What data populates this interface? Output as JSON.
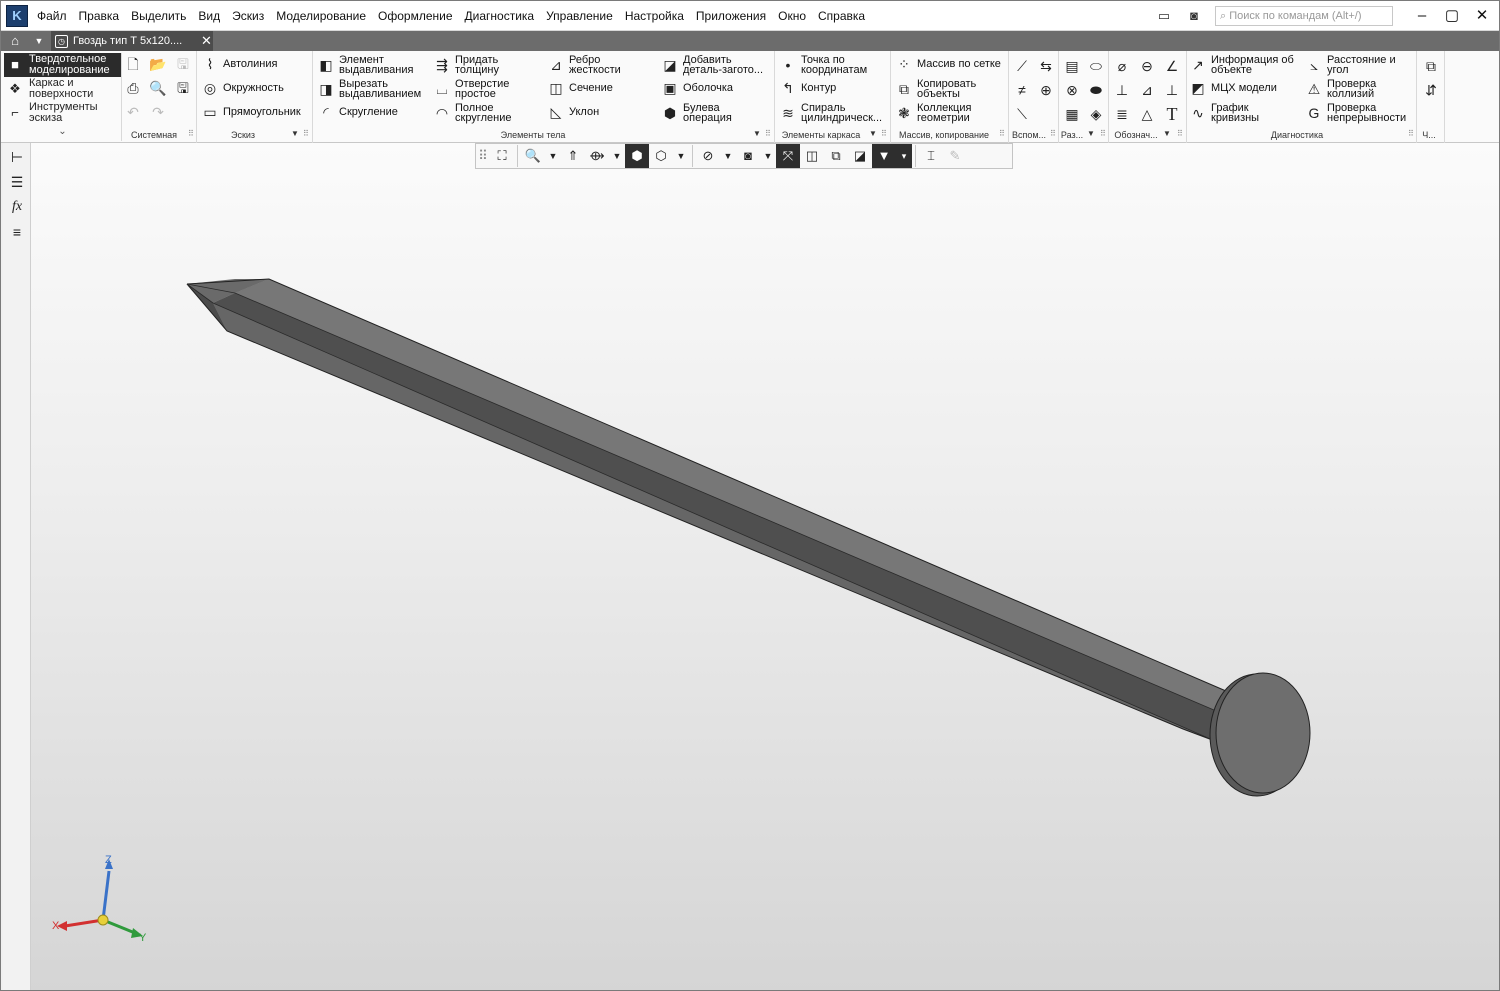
{
  "menu": [
    "Файл",
    "Правка",
    "Выделить",
    "Вид",
    "Эскиз",
    "Моделирование",
    "Оформление",
    "Диагностика",
    "Управление",
    "Настройка",
    "Приложения",
    "Окно",
    "Справка"
  ],
  "search": {
    "placeholder": "Поиск по командам (Alt+/)"
  },
  "document": {
    "tab_title": "Гвоздь тип Т 5х120...."
  },
  "modes": [
    {
      "label": "Твердотельное моделирование",
      "icon": "solid-modeling-icon",
      "active": true
    },
    {
      "label": "Каркас и поверхности",
      "icon": "wireframe-surfaces-icon",
      "active": false
    },
    {
      "label": "Инструменты эскиза",
      "icon": "sketch-tools-icon",
      "active": false
    }
  ],
  "groups": {
    "system": "Системная",
    "sketch": "Эскиз",
    "body": "Элементы тела",
    "frame": "Элементы каркаса",
    "array": "Массив, копирование",
    "aux": "Вспом...",
    "sections": "Раз...",
    "notations": "Обознач...",
    "diagnostics": "Диагностика",
    "ch": "Ч..."
  },
  "sketch_buttons": [
    "Автолиния",
    "Окружность",
    "Прямоугольник"
  ],
  "body_buttons": [
    [
      "Элемент",
      "выдавливания"
    ],
    [
      "Вырезать",
      "выдавливанием"
    ],
    [
      "Скругление"
    ],
    [
      "Придать",
      "толщину"
    ],
    [
      "Отверстие",
      "простое"
    ],
    [
      "Полное",
      "скругление"
    ],
    [
      "Ребро",
      "жесткости"
    ],
    [
      "Сечение"
    ],
    [
      "Уклон"
    ],
    [
      "Добавить",
      "деталь-загото..."
    ],
    [
      "Оболочка"
    ],
    [
      "Булева",
      "операция"
    ]
  ],
  "frame_buttons": [
    [
      "Точка по",
      "координатам"
    ],
    [
      "Контур"
    ],
    [
      "Спираль",
      "цилиндрическ..."
    ]
  ],
  "array_buttons": [
    [
      "Массив по сетке"
    ],
    [
      "Копировать",
      "объекты"
    ],
    [
      "Коллекция",
      "геометрии"
    ]
  ],
  "diag_buttons": [
    [
      "Информация об",
      "объекте"
    ],
    [
      "МЦХ модели"
    ],
    [
      "График",
      "кривизны"
    ],
    [
      "Расстояние и",
      "угол"
    ],
    [
      "Проверка",
      "коллизий"
    ],
    [
      "Проверка",
      "непрерывности"
    ]
  ],
  "triad": {
    "x": "X",
    "y": "Y",
    "z": "Z"
  },
  "colors": {
    "accent_dark": "#2b2b2b",
    "tab_bar": "#6c6c6c",
    "model_gray": "#6f6f6f",
    "axis_x": "#d23030",
    "axis_y": "#2f9a3c",
    "axis_z": "#3a72c8"
  }
}
